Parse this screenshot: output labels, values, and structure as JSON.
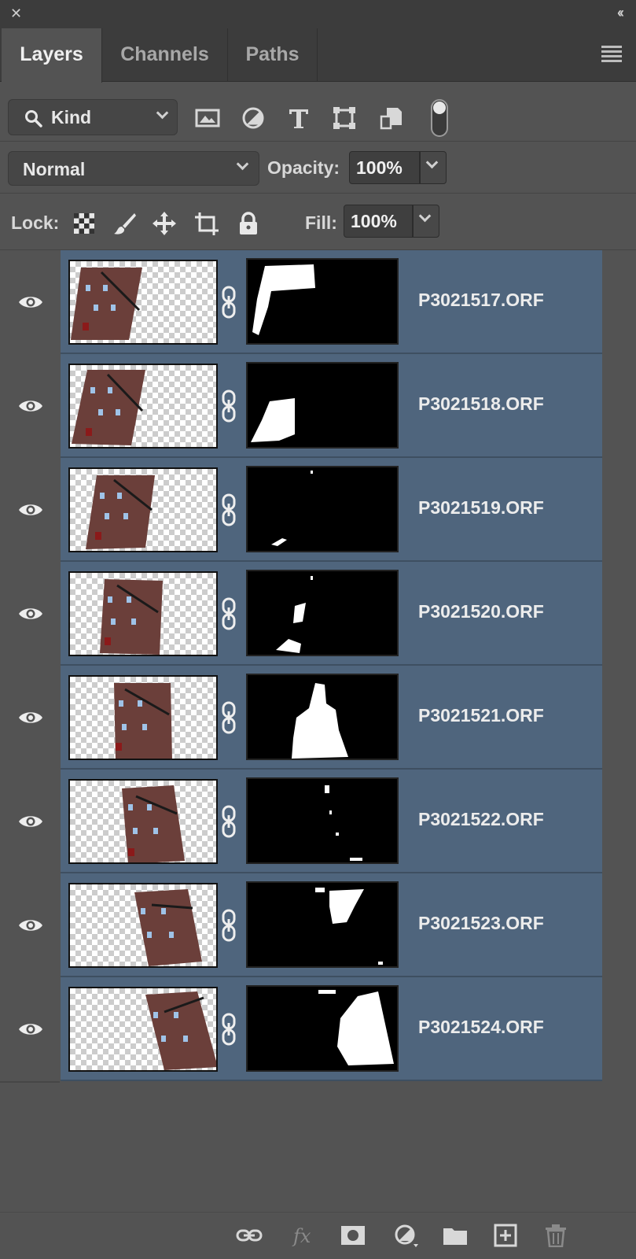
{
  "window": {
    "close_icon": "close-icon",
    "collapse_icon": "collapse-icon"
  },
  "tabs": [
    {
      "label": "Layers",
      "active": true
    },
    {
      "label": "Channels",
      "active": false
    },
    {
      "label": "Paths",
      "active": false
    }
  ],
  "filter": {
    "kind_label": "Kind",
    "icons": [
      "image-filter-icon",
      "adjustment-filter-icon",
      "type-filter-icon",
      "shape-filter-icon",
      "smart-object-filter-icon"
    ],
    "toggle_on": true
  },
  "blend": {
    "mode": "Normal",
    "opacity_label": "Opacity:",
    "opacity_value": "100%"
  },
  "lock": {
    "label": "Lock:",
    "icons": [
      "lock-transparent-pixels-icon",
      "lock-image-pixels-icon",
      "lock-position-icon",
      "lock-artboard-icon",
      "lock-all-icon"
    ],
    "fill_label": "Fill:",
    "fill_value": "100%"
  },
  "layers": [
    {
      "name": "P3021517.ORF",
      "visible": true,
      "selected": true
    },
    {
      "name": "P3021518.ORF",
      "visible": true,
      "selected": true
    },
    {
      "name": "P3021519.ORF",
      "visible": true,
      "selected": true
    },
    {
      "name": "P3021520.ORF",
      "visible": true,
      "selected": true
    },
    {
      "name": "P3021521.ORF",
      "visible": true,
      "selected": true
    },
    {
      "name": "P3021522.ORF",
      "visible": true,
      "selected": true
    },
    {
      "name": "P3021523.ORF",
      "visible": true,
      "selected": true
    },
    {
      "name": "P3021524.ORF",
      "visible": true,
      "selected": true
    }
  ],
  "bottom_icons": [
    "link-layers-icon",
    "fx-icon",
    "add-mask-icon",
    "adjustment-layer-icon",
    "new-group-icon",
    "new-layer-icon",
    "delete-icon"
  ],
  "colors": {
    "panel_bg": "#535353",
    "selected_layer": "#4f657d",
    "tab_bar": "#3c3c3c"
  }
}
